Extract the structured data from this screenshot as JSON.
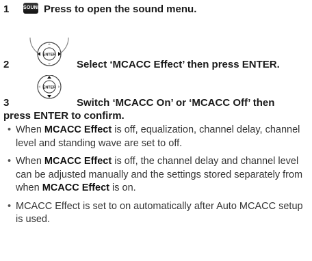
{
  "steps": [
    {
      "num": "1",
      "button": "SOUND",
      "text": "Press to open the sound menu."
    },
    {
      "num": "2",
      "button": "ENTER",
      "text": "Select ‘MCACC Effect’ then press ENTER."
    },
    {
      "num": "3",
      "button": "ENTER",
      "text_line1": "Switch ‘MCACC On’ or ‘MCACC Off’ then",
      "text_line2": "press ENTER to confirm."
    }
  ],
  "bullets": [
    {
      "pre": "When ",
      "bold": "MCACC Effect",
      "post": " is off, equalization, channel delay, channel level and standing wave are set to off."
    },
    {
      "pre": "When ",
      "bold": "MCACC Effect",
      "mid": " is off, the channel delay and channel level can be adjusted manually and the settings stored separately from when ",
      "bold2": "MCACC Effect",
      "post": " is on."
    },
    {
      "text": "MCACC Effect is set to on automatically after Auto MCACC setup is used."
    }
  ]
}
